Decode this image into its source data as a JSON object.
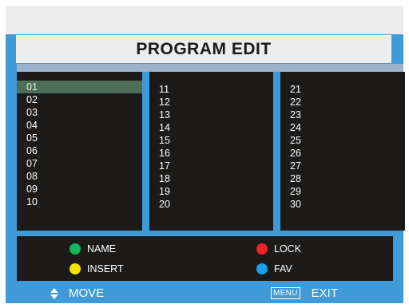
{
  "title": "PROGRAM EDIT",
  "columns": [
    [
      "01",
      "02",
      "03",
      "04",
      "05",
      "06",
      "07",
      "08",
      "09",
      "10"
    ],
    [
      "11",
      "12",
      "13",
      "14",
      "15",
      "16",
      "17",
      "18",
      "19",
      "20"
    ],
    [
      "21",
      "22",
      "23",
      "24",
      "25",
      "26",
      "27",
      "28",
      "29",
      "30"
    ]
  ],
  "selected_program": "01",
  "legend": {
    "name": {
      "label": "NAME",
      "color": "#12b85a"
    },
    "lock": {
      "label": "LOCK",
      "color": "#ee2424"
    },
    "insert": {
      "label": "INSERT",
      "color": "#f2e300"
    },
    "fav": {
      "label": "FAV",
      "color": "#1aa0ea"
    }
  },
  "footer": {
    "move_label": "MOVE",
    "move_icon": "up-down-arrow-icon",
    "menu_key": "MENU",
    "exit_label": "EXIT"
  },
  "colors": {
    "frame": "#3e9bd8",
    "panel": "#1c1b1a",
    "header": "#ececec",
    "selection": "#4f6e58"
  }
}
